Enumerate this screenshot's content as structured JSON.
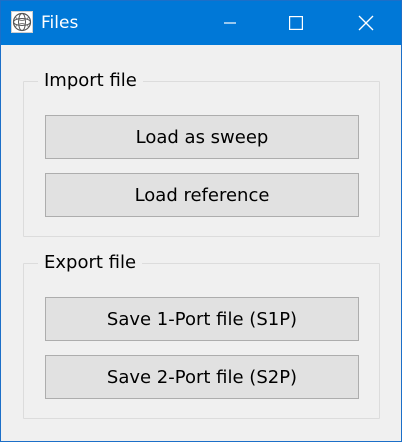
{
  "window": {
    "title": "Files",
    "accent_color": "#0078d7",
    "app_icon": "sphere-mesh-icon",
    "caption_icons": [
      "minimize-icon",
      "maximize-icon",
      "close-icon"
    ]
  },
  "import_group": {
    "label": "Import file",
    "buttons": [
      "Load as sweep",
      "Load reference"
    ]
  },
  "export_group": {
    "label": "Export file",
    "buttons": [
      "Save 1-Port file (S1P)",
      "Save 2-Port file (S2P)"
    ]
  }
}
